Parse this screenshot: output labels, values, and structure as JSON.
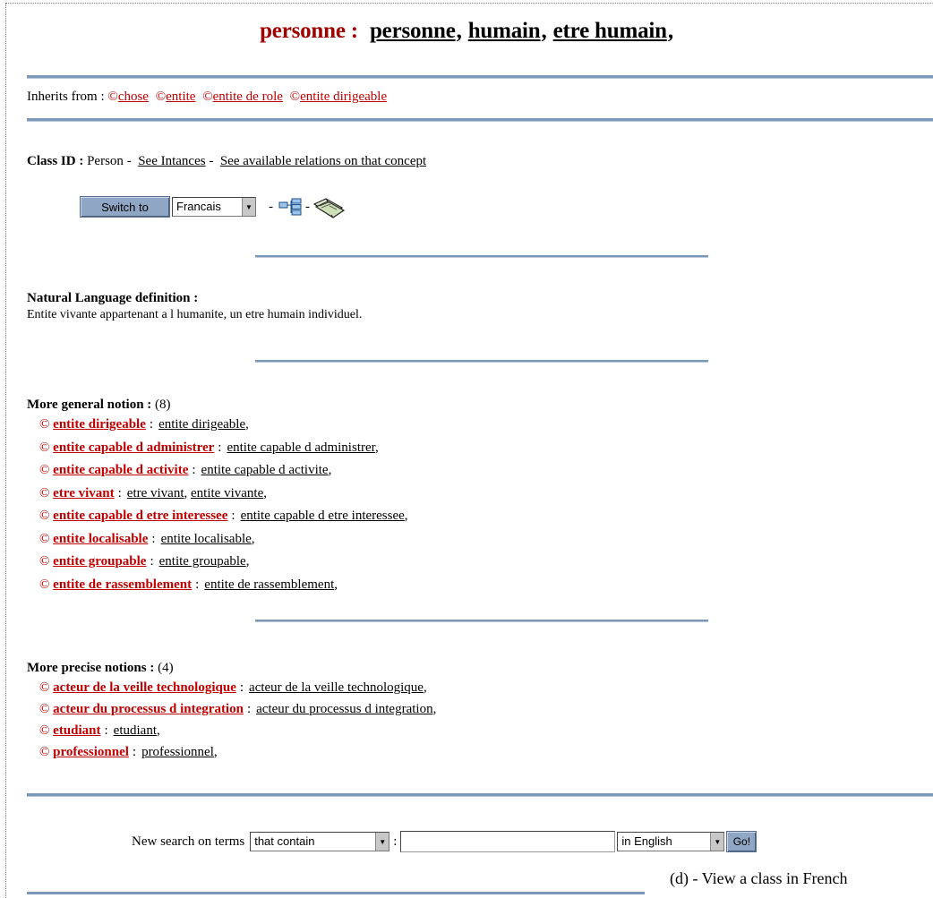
{
  "title": {
    "concept": "personne :",
    "terms": [
      "personne",
      "humain",
      "etre humain"
    ]
  },
  "inherits": {
    "label": "Inherits from :",
    "items": [
      "chose",
      "entite",
      "entite de role",
      "entite dirigeable"
    ]
  },
  "class_info": {
    "id_label": "Class ID :",
    "id_value": "Person",
    "see_instances": "See Intances",
    "see_relations": "See available relations on that concept"
  },
  "switch": {
    "button_label": "Switch to",
    "language": "Francais",
    "tree_icon": "hierarchy-tree-icon",
    "book_icon": "open-book-icon"
  },
  "definition": {
    "title": "Natural Language definition :",
    "text": "Entite vivante appartenant a l humanite, un etre humain individuel."
  },
  "general": {
    "title": "More general notion :",
    "count": "(8)",
    "items": [
      {
        "name": "entite dirigeable",
        "terms": [
          "entite dirigeable"
        ]
      },
      {
        "name": "entite capable d administrer",
        "terms": [
          "entite capable d administrer"
        ]
      },
      {
        "name": "entite capable d activite",
        "terms": [
          "entite capable d activite"
        ]
      },
      {
        "name": "etre vivant",
        "terms": [
          "etre vivant",
          "entite vivante"
        ]
      },
      {
        "name": "entite capable d etre interessee",
        "terms": [
          "entite capable d etre interessee"
        ]
      },
      {
        "name": "entite localisable",
        "terms": [
          "entite localisable"
        ]
      },
      {
        "name": "entite groupable",
        "terms": [
          "entite groupable"
        ]
      },
      {
        "name": "entite de rassemblement",
        "terms": [
          "entite de rassemblement"
        ]
      }
    ]
  },
  "precise": {
    "title": "More precise notions :",
    "count": "(4)",
    "items": [
      {
        "name": "acteur de la veille technologique",
        "terms": [
          "acteur de la veille technologique"
        ]
      },
      {
        "name": "acteur du processus d integration",
        "terms": [
          "acteur du processus d integration"
        ]
      },
      {
        "name": "etudiant",
        "terms": [
          "etudiant"
        ]
      },
      {
        "name": "professionnel",
        "terms": [
          "professionnel"
        ]
      }
    ]
  },
  "search": {
    "label": "New search on terms",
    "match_mode": "that contain",
    "query": "",
    "language": "in English",
    "go_label": "Go!"
  },
  "caption": "(d) - View a class in French",
  "colors": {
    "concept_red": "#a00000",
    "link_red": "#c00000",
    "separator_blue": "#7a98b8",
    "button_blue": "#8fa6c4"
  }
}
